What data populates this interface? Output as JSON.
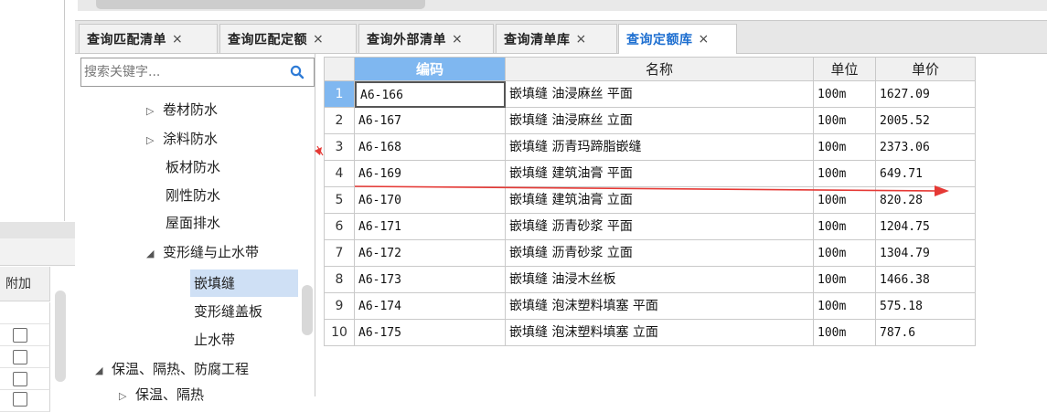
{
  "tabs": [
    {
      "label": "查询匹配清单",
      "close": "×"
    },
    {
      "label": "查询匹配定额",
      "close": "×"
    },
    {
      "label": "查询外部清单",
      "close": "×"
    },
    {
      "label": "查询清单库",
      "close": "×"
    },
    {
      "label": "查询定额库",
      "close": "×",
      "active": true
    }
  ],
  "search": {
    "placeholder": "搜索关键字...",
    "value": ""
  },
  "tree": [
    {
      "label": "卷材防水",
      "arrow": "▷"
    },
    {
      "label": "涂料防水",
      "arrow": "▷"
    },
    {
      "label": "板材防水",
      "arrow": ""
    },
    {
      "label": "刚性防水",
      "arrow": ""
    },
    {
      "label": "屋面排水",
      "arrow": ""
    },
    {
      "label": "变形缝与止水带",
      "arrow": "◢"
    },
    {
      "label": "嵌填缝",
      "arrow": "",
      "selected": true
    },
    {
      "label": "变形缝盖板",
      "arrow": ""
    },
    {
      "label": "止水带",
      "arrow": ""
    },
    {
      "label": "保温、隔热、防腐工程",
      "arrow": "◢"
    },
    {
      "label": "保温、隔热",
      "arrow": "▷"
    }
  ],
  "grid": {
    "headers": {
      "code": "编码",
      "name": "名称",
      "unit": "单位",
      "price": "单价"
    },
    "rows": [
      {
        "n": "1",
        "code": "A6-166",
        "name": "嵌填缝 油浸麻丝 平面",
        "unit": "100m",
        "price": "1627.09"
      },
      {
        "n": "2",
        "code": "A6-167",
        "name": "嵌填缝 油浸麻丝 立面",
        "unit": "100m",
        "price": "2005.52"
      },
      {
        "n": "3",
        "code": "A6-168",
        "name": "嵌填缝 沥青玛蹄脂嵌缝",
        "unit": "100m",
        "price": "2373.06"
      },
      {
        "n": "4",
        "code": "A6-169",
        "name": "嵌填缝 建筑油膏 平面",
        "unit": "100m",
        "price": "649.71"
      },
      {
        "n": "5",
        "code": "A6-170",
        "name": "嵌填缝 建筑油膏 立面",
        "unit": "100m",
        "price": "820.28"
      },
      {
        "n": "6",
        "code": "A6-171",
        "name": "嵌填缝 沥青砂浆 平面",
        "unit": "100m",
        "price": "1204.75"
      },
      {
        "n": "7",
        "code": "A6-172",
        "name": "嵌填缝 沥青砂浆 立面",
        "unit": "100m",
        "price": "1304.79"
      },
      {
        "n": "8",
        "code": "A6-173",
        "name": "嵌填缝 油浸木丝板",
        "unit": "100m",
        "price": "1466.38"
      },
      {
        "n": "9",
        "code": "A6-174",
        "name": "嵌填缝 泡沫塑料填塞 平面",
        "unit": "100m",
        "price": "575.18"
      },
      {
        "n": "10",
        "code": "A6-175",
        "name": "嵌填缝 泡沫塑料填塞 立面",
        "unit": "100m",
        "price": "787.6"
      }
    ]
  },
  "left_panel": {
    "column_header": "附加"
  },
  "colors": {
    "accent": "#1e6fd0",
    "selection": "#7fb7f0",
    "annotation": "#e53935"
  }
}
